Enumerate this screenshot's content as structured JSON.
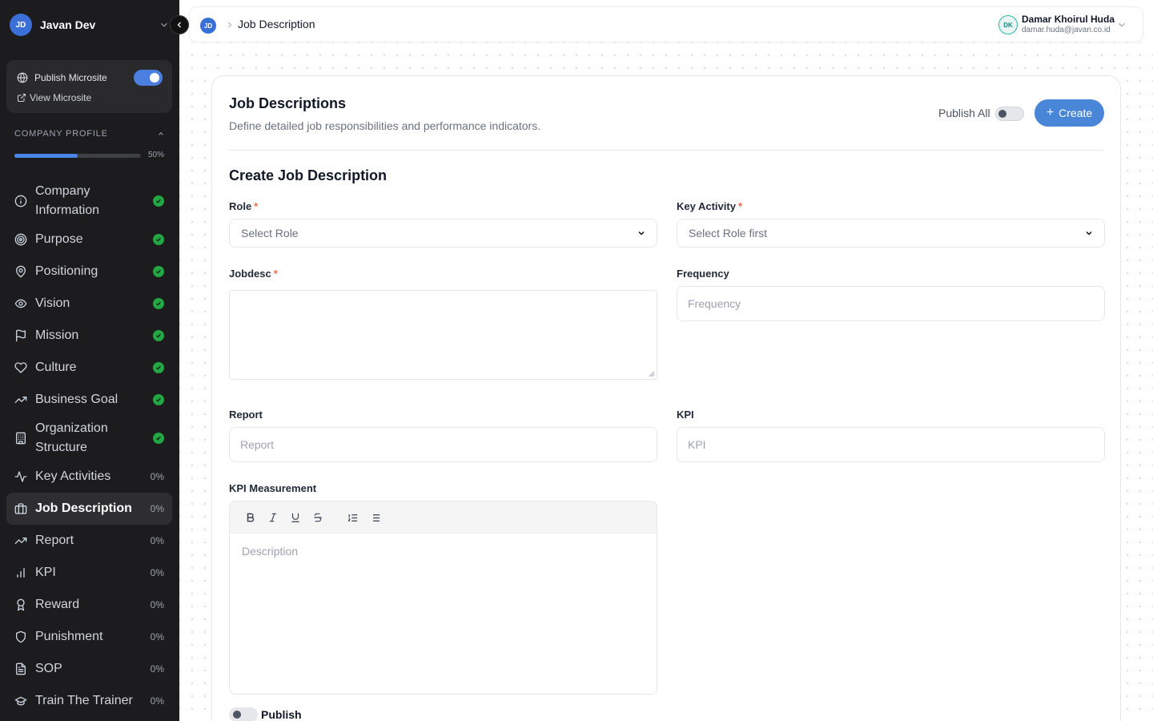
{
  "workspace": {
    "initials": "JD",
    "name": "Javan Dev"
  },
  "microsite": {
    "publish_label": "Publish Microsite",
    "publish_on": true,
    "view_label": "View Microsite"
  },
  "company_profile": {
    "heading": "COMPANY PROFILE",
    "progress": 0.5,
    "progress_label": "50%"
  },
  "nav": [
    {
      "id": "company-information",
      "label_lines": [
        "Company",
        "Information"
      ],
      "icon": "info-icon",
      "status": "done"
    },
    {
      "id": "purpose",
      "label_lines": [
        "Purpose"
      ],
      "icon": "target-icon",
      "status": "done"
    },
    {
      "id": "positioning",
      "label_lines": [
        "Positioning"
      ],
      "icon": "map-pin-icon",
      "status": "done"
    },
    {
      "id": "vision",
      "label_lines": [
        "Vision"
      ],
      "icon": "eye-icon",
      "status": "done"
    },
    {
      "id": "mission",
      "label_lines": [
        "Mission"
      ],
      "icon": "flag-icon",
      "status": "done"
    },
    {
      "id": "culture",
      "label_lines": [
        "Culture"
      ],
      "icon": "heart-icon",
      "status": "done"
    },
    {
      "id": "business-goal",
      "label_lines": [
        "Business Goal"
      ],
      "icon": "trending-up-icon",
      "status": "done"
    },
    {
      "id": "organization-structure",
      "label_lines": [
        "Organization",
        "Structure"
      ],
      "icon": "building-icon",
      "status": "done"
    },
    {
      "id": "key-activities",
      "label_lines": [
        "Key Activities"
      ],
      "icon": "activity-icon",
      "status": "0%"
    },
    {
      "id": "job-description",
      "label_lines": [
        "Job Description"
      ],
      "icon": "briefcase-icon",
      "status": "0%",
      "active": true
    },
    {
      "id": "report",
      "label_lines": [
        "Report"
      ],
      "icon": "trending-up-icon",
      "status": "0%"
    },
    {
      "id": "kpi",
      "label_lines": [
        "KPI"
      ],
      "icon": "bar-chart-icon",
      "status": "0%"
    },
    {
      "id": "reward",
      "label_lines": [
        "Reward"
      ],
      "icon": "award-icon",
      "status": "0%"
    },
    {
      "id": "punishment",
      "label_lines": [
        "Punishment"
      ],
      "icon": "shield-icon",
      "status": "0%"
    },
    {
      "id": "sop",
      "label_lines": [
        "SOP"
      ],
      "icon": "file-text-icon",
      "status": "0%"
    },
    {
      "id": "train-the-trainer",
      "label_lines": [
        "Train The Trainer"
      ],
      "icon": "graduation-cap-icon",
      "status": "0%"
    }
  ],
  "topbar": {
    "breadcrumb_initials": "JD",
    "breadcrumb_title": "Job Description",
    "user": {
      "initials": "DK",
      "name": "Damar Khoirul Huda",
      "email": "damar.huda@javan.co.id"
    }
  },
  "page": {
    "title": "Job Descriptions",
    "subtitle": "Define detailed job responsibilities and performance indicators.",
    "publish_all_label": "Publish All",
    "publish_all_on": false,
    "create_label": "Create"
  },
  "form": {
    "section_title": "Create Job Description",
    "role": {
      "label": "Role",
      "placeholder": "Select Role",
      "required": true
    },
    "key_activity": {
      "label": "Key Activity",
      "placeholder": "Select Role first",
      "required": true
    },
    "jobdesc": {
      "label": "Jobdesc",
      "value": "",
      "required": true
    },
    "frequency": {
      "label": "Frequency",
      "placeholder": "Frequency"
    },
    "report": {
      "label": "Report",
      "placeholder": "Report"
    },
    "kpi": {
      "label": "KPI",
      "placeholder": "KPI"
    },
    "kpi_measurement": {
      "label": "KPI Measurement",
      "placeholder": "Description",
      "toolbar": [
        "bold-icon",
        "italic-icon",
        "underline-icon",
        "strikethrough-icon",
        "ordered-list-icon",
        "bullet-list-icon"
      ]
    },
    "publish": {
      "label": "Publish",
      "on": false
    }
  },
  "colors": {
    "accent": "#4a86d8",
    "sidebar_bg": "#1c1c1e",
    "done": "#22a744",
    "required": "#ef6b4a"
  }
}
